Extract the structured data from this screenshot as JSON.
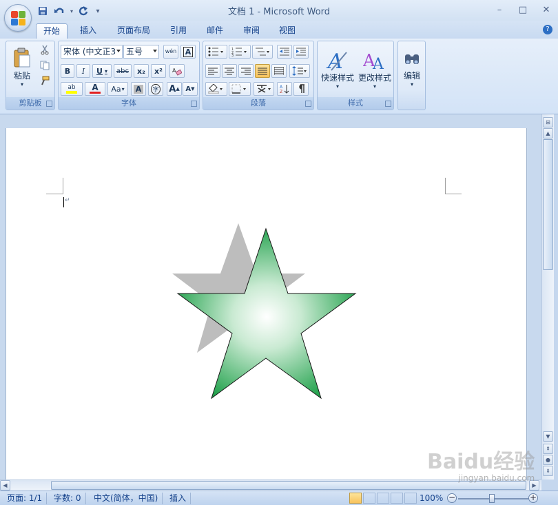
{
  "app": {
    "title": "文档 1 - Microsoft Word",
    "help_glyph": "?"
  },
  "quick_access": [
    "save-icon",
    "undo-icon",
    "redo-icon",
    "customize-icon"
  ],
  "window_controls": {
    "minimize": "–",
    "maximize": "□",
    "close": "✕"
  },
  "tabs": [
    "开始",
    "插入",
    "页面布局",
    "引用",
    "邮件",
    "审阅",
    "视图"
  ],
  "active_tab": "开始",
  "ribbon": {
    "clipboard": {
      "label": "剪贴板",
      "paste": "粘贴"
    },
    "font": {
      "label": "字体",
      "font_name": "宋体 (中文正3",
      "font_size": "五号",
      "phonetic_glyph": "wén",
      "border_glyph": "A",
      "bold": "B",
      "italic": "I",
      "underline": "U",
      "strike": "abc",
      "subscript": "x₂",
      "superscript": "x²",
      "highlight": "ab",
      "font_color": "A",
      "change_case": "Aa",
      "shading": "A",
      "enclose": "字",
      "grow": "A",
      "shrink": "A"
    },
    "paragraph": {
      "label": "段落"
    },
    "styles": {
      "label": "样式",
      "quick_styles": "快速样式",
      "change_styles": "更改样式"
    },
    "editing": {
      "label": "编辑"
    }
  },
  "status": {
    "page": "页面: 1/1",
    "words": "字数: 0",
    "language": "中文(简体，中国)",
    "mode": "插入",
    "zoom": "100%",
    "zoom_minus": "−",
    "zoom_plus": "+"
  },
  "watermark": {
    "text": "Baidu经验",
    "sub": "jingyan.baidu.com"
  },
  "colors": {
    "star_gradient_center": "#ffffff",
    "star_gradient_edge": "#1fa04a",
    "shadow": "#bdbdbd",
    "accent": "#15428b"
  }
}
